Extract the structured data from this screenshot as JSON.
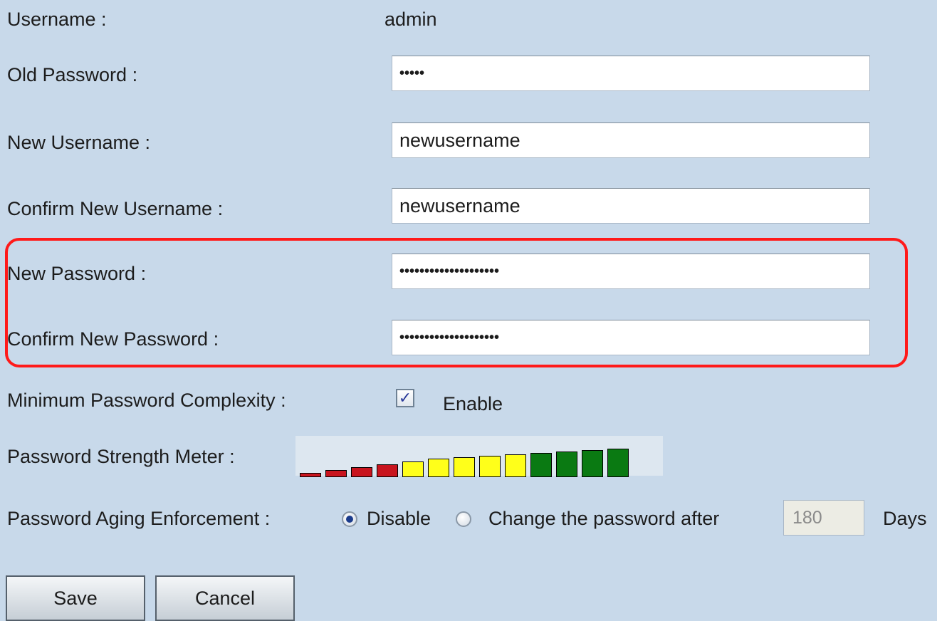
{
  "form": {
    "username": {
      "label": "Username :",
      "value": "admin"
    },
    "old_password": {
      "label": "Old Password :",
      "value": "•••••"
    },
    "new_username": {
      "label": "New Username :",
      "value": "newusername"
    },
    "confirm_new_username": {
      "label": "Confirm New Username :",
      "value": "newusername"
    },
    "new_password": {
      "label": "New Password :",
      "value": "••••••••••••••••••••"
    },
    "confirm_new_password": {
      "label": "Confirm New Password :",
      "value": "••••••••••••••••••••"
    },
    "min_complexity": {
      "label": "Minimum Password Complexity :",
      "checkbox_label": "Enable",
      "checked": true,
      "check_glyph": "✓"
    },
    "strength_meter": {
      "label": "Password Strength Meter :",
      "level": 1.0,
      "segment_colors": {
        "weak": "#c8141e",
        "medium": "#ffff1a",
        "strong": "#0a7a12"
      }
    },
    "aging": {
      "label": "Password Aging Enforcement :",
      "option_disable": "Disable",
      "option_change": "Change the password after",
      "selected": "Disable",
      "days_value": "180",
      "days_unit": "Days"
    }
  },
  "buttons": {
    "save": "Save",
    "cancel": "Cancel"
  },
  "colors": {
    "background": "#c8d9ea",
    "highlight": "#ff1a1a"
  }
}
